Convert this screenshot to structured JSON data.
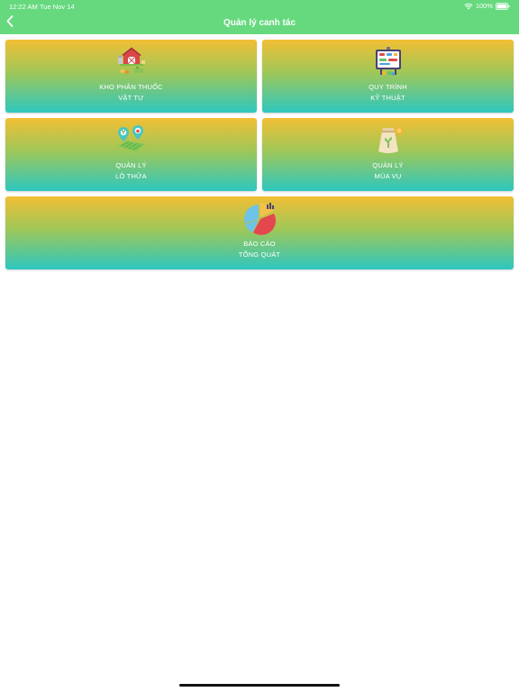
{
  "status_bar": {
    "time": "12:22 AM",
    "date": "Tue Nov 14",
    "battery": "100%"
  },
  "nav": {
    "title": "Quản lý canh tác",
    "back_icon": "chevron-left-icon"
  },
  "colors": {
    "header": "#66d97e",
    "card_top": "#f2bf35",
    "card_bottom": "#2dc7c0",
    "text": "#ffffff"
  },
  "cards": [
    {
      "line1": "KHO PHÂN THUỐC",
      "line2": "VẬT TƯ",
      "icon": "farm-barn-icon"
    },
    {
      "line1": "QUY TRÌNH",
      "line2": "KỸ THUẬT",
      "icon": "process-board-icon"
    },
    {
      "line1": "QUẢN LÝ",
      "line2": "LÔ THỬA",
      "icon": "land-plot-icon"
    },
    {
      "line1": "QUẢN LÝ",
      "line2": "MÙA VỤ",
      "icon": "seed-bag-icon"
    },
    {
      "line1": "BÁO CÁO",
      "line2": "TỔNG QUÁT",
      "icon": "pie-chart-icon"
    }
  ]
}
